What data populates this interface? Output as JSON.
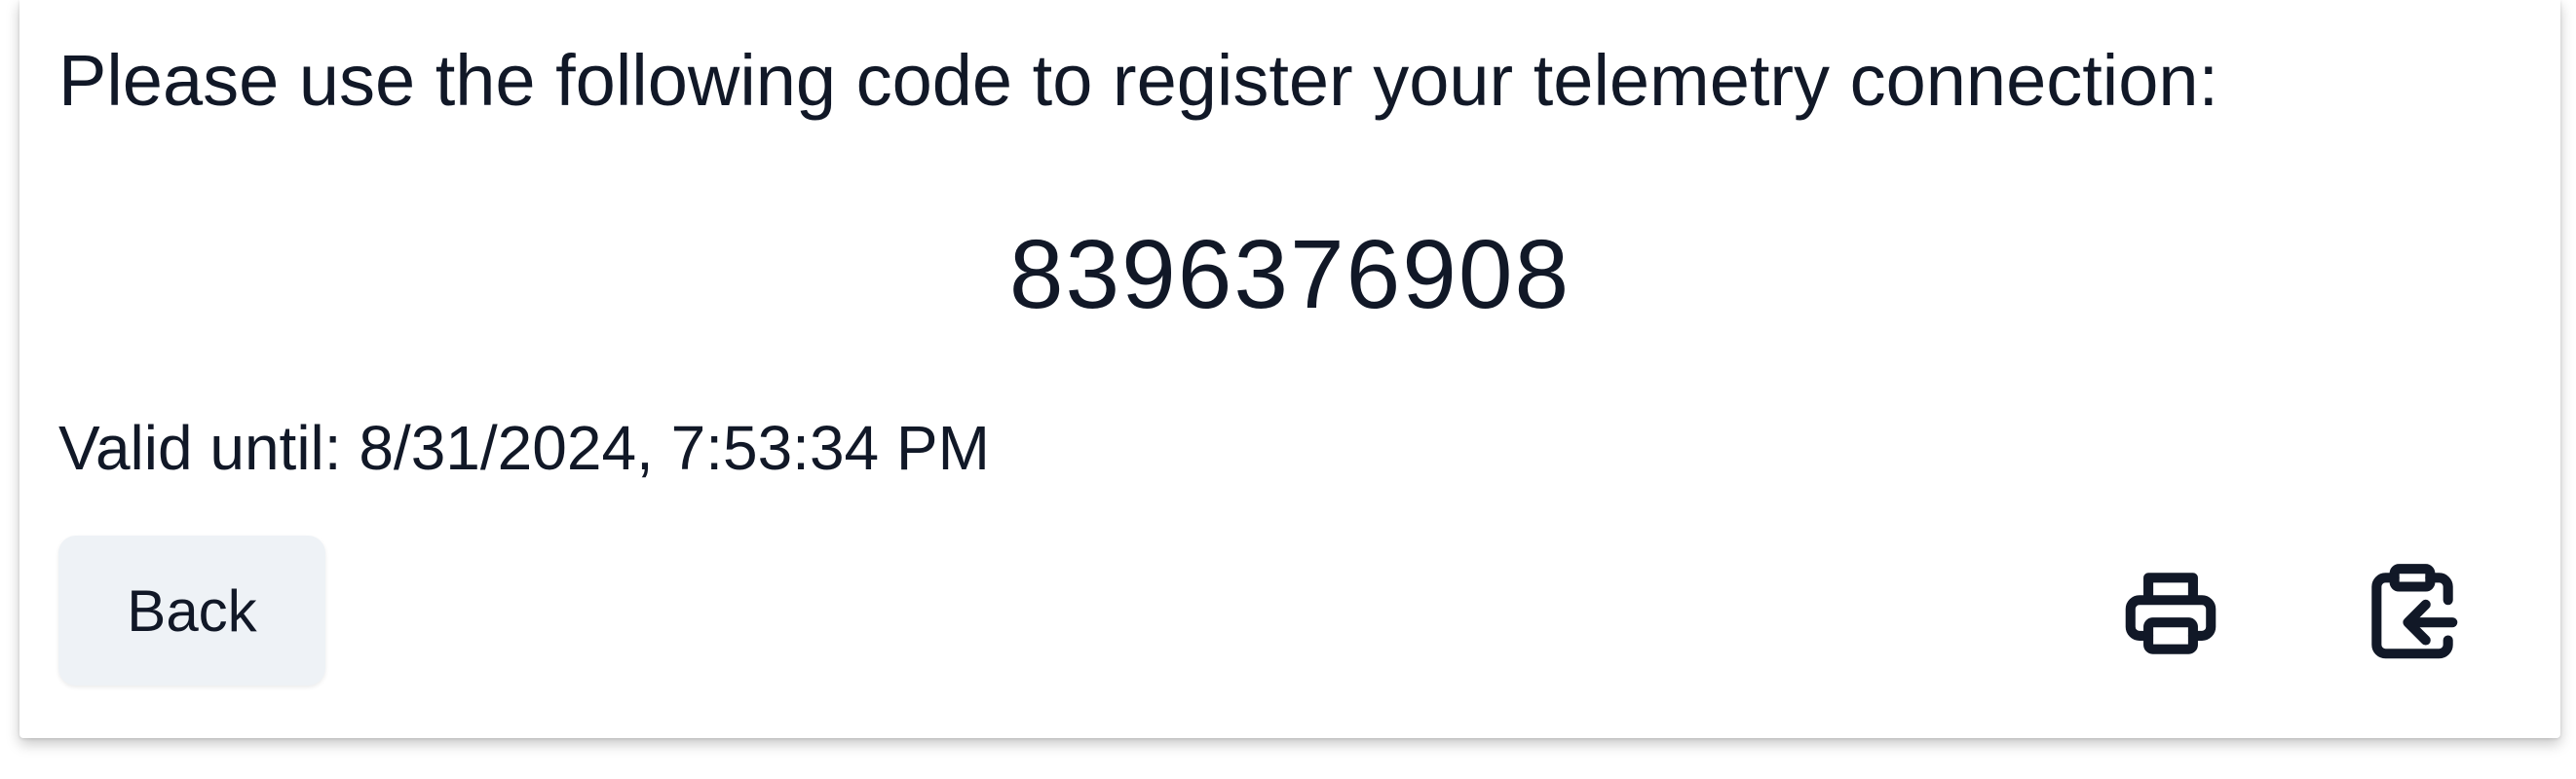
{
  "registration": {
    "instruction": "Please use the following code to register your telemetry connection:",
    "code": "8396376908",
    "valid_until": "Valid until: 8/31/2024, 7:53:34 PM"
  },
  "actions": {
    "back_label": "Back",
    "print_icon": "printer-icon",
    "copy_icon": "clipboard-copy-icon"
  },
  "colors": {
    "text": "#111827",
    "button_bg": "#eef2f6",
    "card_bg": "#ffffff"
  }
}
